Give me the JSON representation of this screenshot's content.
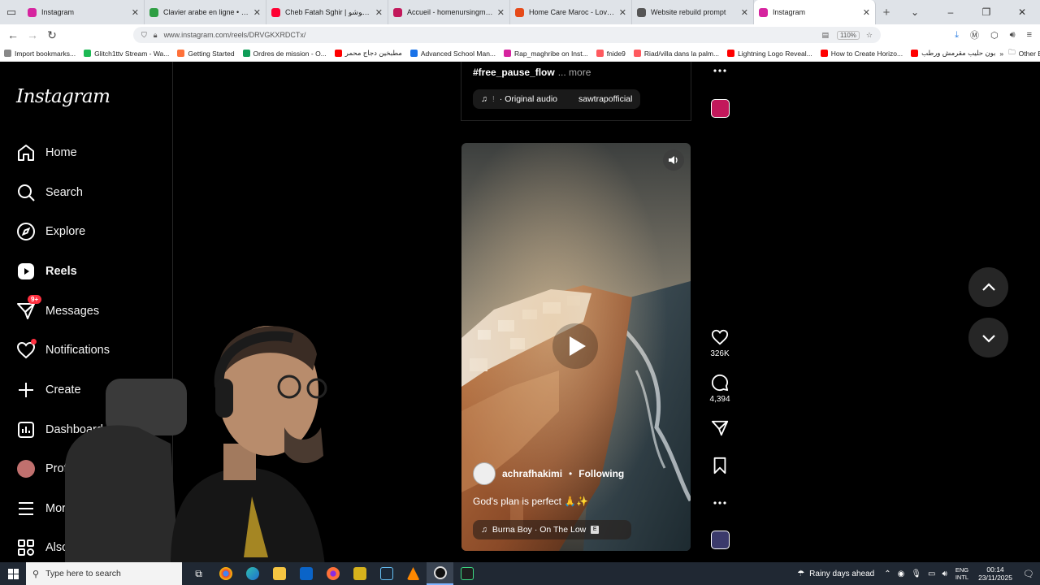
{
  "browser": {
    "tabs": [
      {
        "title": "Instagram",
        "color": "#d6249f",
        "active": false
      },
      {
        "title": "Clavier arabe en ligne • Lexilogos",
        "color": "#2e9e43",
        "active": false
      },
      {
        "title": "Cheb Fatah Sghir | شاب فتاح شوشو ...",
        "color": "#ff0033",
        "active": false
      },
      {
        "title": "Accueil - homenursingmaroc",
        "color": "#c2185b",
        "active": false
      },
      {
        "title": "Home Care Maroc - Lovable",
        "color": "#e64a19",
        "active": false
      },
      {
        "title": "Website rebuild prompt",
        "color": "#555555",
        "active": false
      },
      {
        "title": "Instagram",
        "color": "#d6249f",
        "active": true
      }
    ],
    "url": "www.instagram.com/reels/DRVGKXRDCTx/",
    "zoom": "110%"
  },
  "bookmarks": [
    {
      "label": "Import bookmarks...",
      "color": "#888888"
    },
    {
      "label": "Glitch1ttv Stream - Wa...",
      "color": "#1db954"
    },
    {
      "label": "Getting Started",
      "color": "#ff7139"
    },
    {
      "label": "Ordres de mission - O...",
      "color": "#0f9d58"
    },
    {
      "label": "مطبخين دجاج محمر",
      "color": "#ff0000"
    },
    {
      "label": "Advanced School Man...",
      "color": "#1a73e8"
    },
    {
      "label": "Rap_maghribe on Inst...",
      "color": "#d6249f"
    },
    {
      "label": "fnide9",
      "color": "#ff5a5f"
    },
    {
      "label": "Riad/villa dans la palm...",
      "color": "#ff5a5f"
    },
    {
      "label": "Lightning Logo Reveal...",
      "color": "#ff0000"
    },
    {
      "label": "How to Create Horizo...",
      "color": "#ff0000"
    },
    {
      "label": "بون حليب مقرمش ورطب",
      "color": "#ff0000"
    }
  ],
  "other_bookmarks": "Other Bookmarks",
  "sidebar": {
    "logo": "Instagram",
    "items": [
      {
        "label": "Home",
        "icon": "home-icon"
      },
      {
        "label": "Search",
        "icon": "search-icon"
      },
      {
        "label": "Explore",
        "icon": "compass-icon"
      },
      {
        "label": "Reels",
        "icon": "reels-icon"
      },
      {
        "label": "Messages",
        "icon": "messenger-icon",
        "badge": "9+"
      },
      {
        "label": "Notifications",
        "icon": "heart-icon"
      },
      {
        "label": "Create",
        "icon": "plus-icon"
      },
      {
        "label": "Dashboard",
        "icon": "dashboard-icon"
      },
      {
        "label": "Profile",
        "icon": "avatar-icon"
      },
      {
        "label": "More",
        "icon": "menu-icon"
      },
      {
        "label": "Also from Meta",
        "icon": "apps-icon"
      }
    ]
  },
  "prev_post": {
    "hashtag": "#free_pause_flow",
    "more": "... more",
    "audio": "· Original audio",
    "audio_prefix": "!",
    "creator": "sawtrapofficial"
  },
  "reel": {
    "username": "achrafhakimi",
    "following": "Following",
    "caption": "God's plan is perfect 🙏✨",
    "audio": "Burna Boy · On The Low",
    "explicit": "E",
    "likes": "326K",
    "comments": "4,394"
  },
  "taskbar": {
    "search_placeholder": "Type here to search",
    "weather": "Rainy days ahead",
    "lang_top": "ENG",
    "lang_bottom": "INTL",
    "time": "00:14",
    "date": "23/11/2025"
  },
  "colors": {
    "accent_badge": "#ff3040",
    "ig_background": "#000000",
    "taskbar": "#202833"
  }
}
